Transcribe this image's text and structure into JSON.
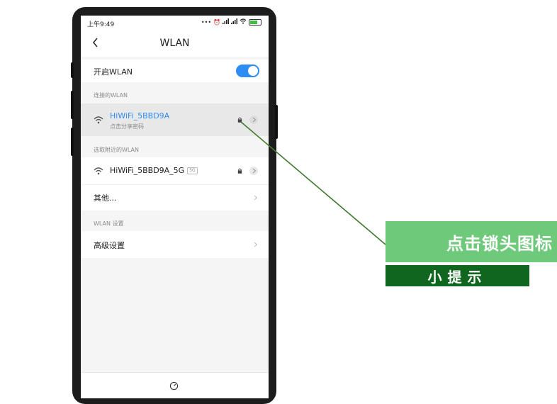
{
  "status_bar": {
    "time": "上午9:49",
    "icons": [
      "dots-icon",
      "alarm-icon",
      "signal-icon",
      "signal-icon",
      "wifi-icon",
      "battery-icon"
    ]
  },
  "header": {
    "title": "WLAN"
  },
  "wlan_toggle": {
    "label": "开启WLAN",
    "on": true
  },
  "connected_section": {
    "label": "连接的WLAN",
    "network": {
      "name": "HiWiFi_5BBD9A",
      "subtitle": "点击分享密码"
    }
  },
  "nearby_section": {
    "label": "选取附近的WLAN",
    "networks": [
      {
        "name": "HiWiFi_5BBD9A_5G",
        "badge": "5G"
      }
    ],
    "other_label": "其他..."
  },
  "settings_section": {
    "label": "WLAN 设置",
    "advanced_label": "高级设置"
  },
  "annotation": {
    "tip_main": "点击锁头图标",
    "tip_sub": "小提示"
  },
  "colors": {
    "accent_blue": "#2e8df3",
    "banner_light": "#6fc97a",
    "banner_dark": "#11661f",
    "pointer_line": "#3f7a2e"
  }
}
